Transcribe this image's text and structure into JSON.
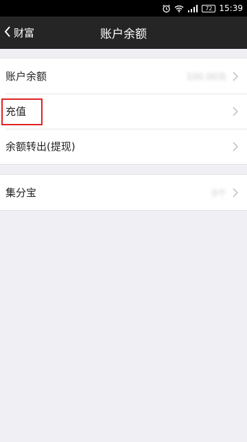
{
  "status_bar": {
    "time": "15:39",
    "battery": "72",
    "icons": [
      "alarm-icon",
      "wifi-icon",
      "signal-icon",
      "battery-icon"
    ]
  },
  "nav": {
    "back_label": "财富",
    "title": "账户余额"
  },
  "group1": {
    "items": [
      {
        "label": "账户余额",
        "value": "100.00元"
      },
      {
        "label": "充值",
        "value": ""
      },
      {
        "label": "余额转出(提现)",
        "value": ""
      }
    ]
  },
  "group2": {
    "items": [
      {
        "label": "集分宝",
        "value": "0个"
      }
    ]
  },
  "colors": {
    "nav_bg": "#252525",
    "page_bg": "#efeff4",
    "highlight": "#e02020"
  }
}
